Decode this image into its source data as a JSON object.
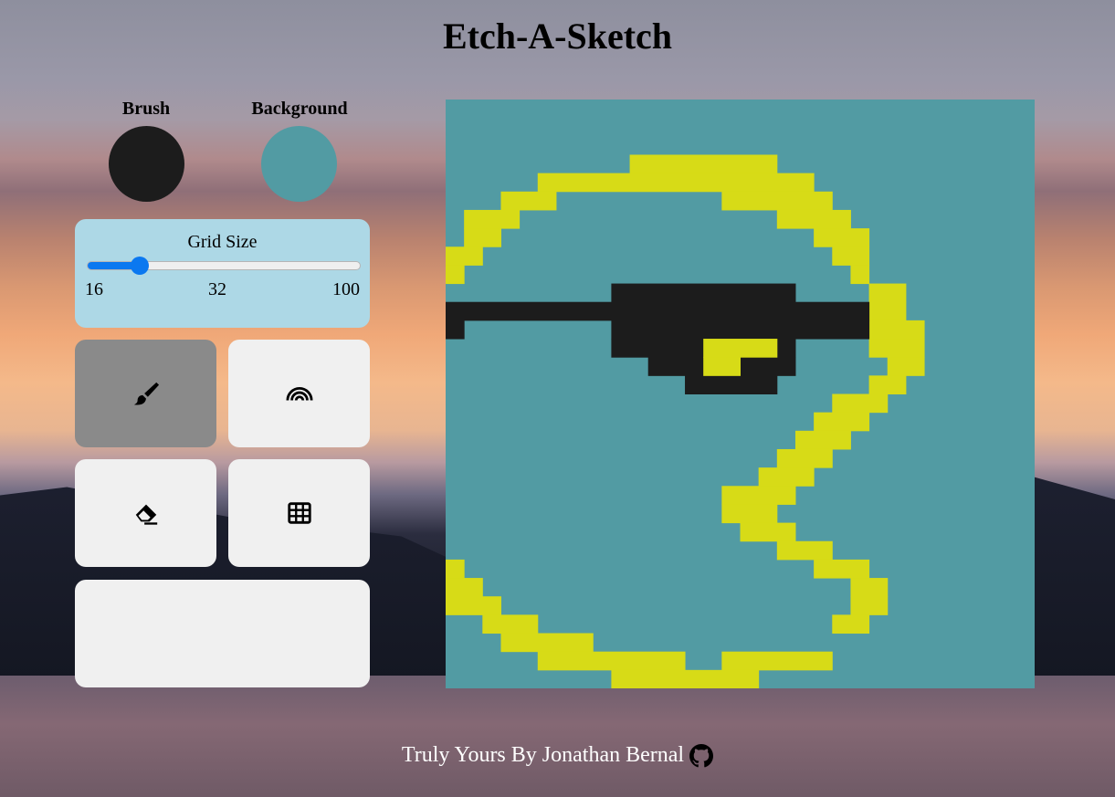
{
  "title": "Etch-A-Sketch",
  "swatches": {
    "brush_label": "Brush",
    "brush_color": "#1c1c1c",
    "background_label": "Background",
    "background_color": "#529ba3"
  },
  "grid_size": {
    "label": "Grid Size",
    "min_label": "16",
    "value_label": "32",
    "max_label": "100",
    "min": 16,
    "max": 100,
    "value": 32
  },
  "tools": [
    {
      "name": "brush",
      "icon": "paintbrush-icon",
      "active": true
    },
    {
      "name": "rainbow",
      "icon": "rainbow-icon",
      "active": false
    },
    {
      "name": "eraser",
      "icon": "eraser-icon",
      "active": false
    },
    {
      "name": "grid",
      "icon": "grid-icon",
      "active": false
    }
  ],
  "colors": {
    "yellow": "#d7db17",
    "black": "#1c1c1c",
    "teal": "#529ba3"
  },
  "footer": {
    "text": "Truly Yours By Jonathan Bernal",
    "icon": "github-icon"
  }
}
